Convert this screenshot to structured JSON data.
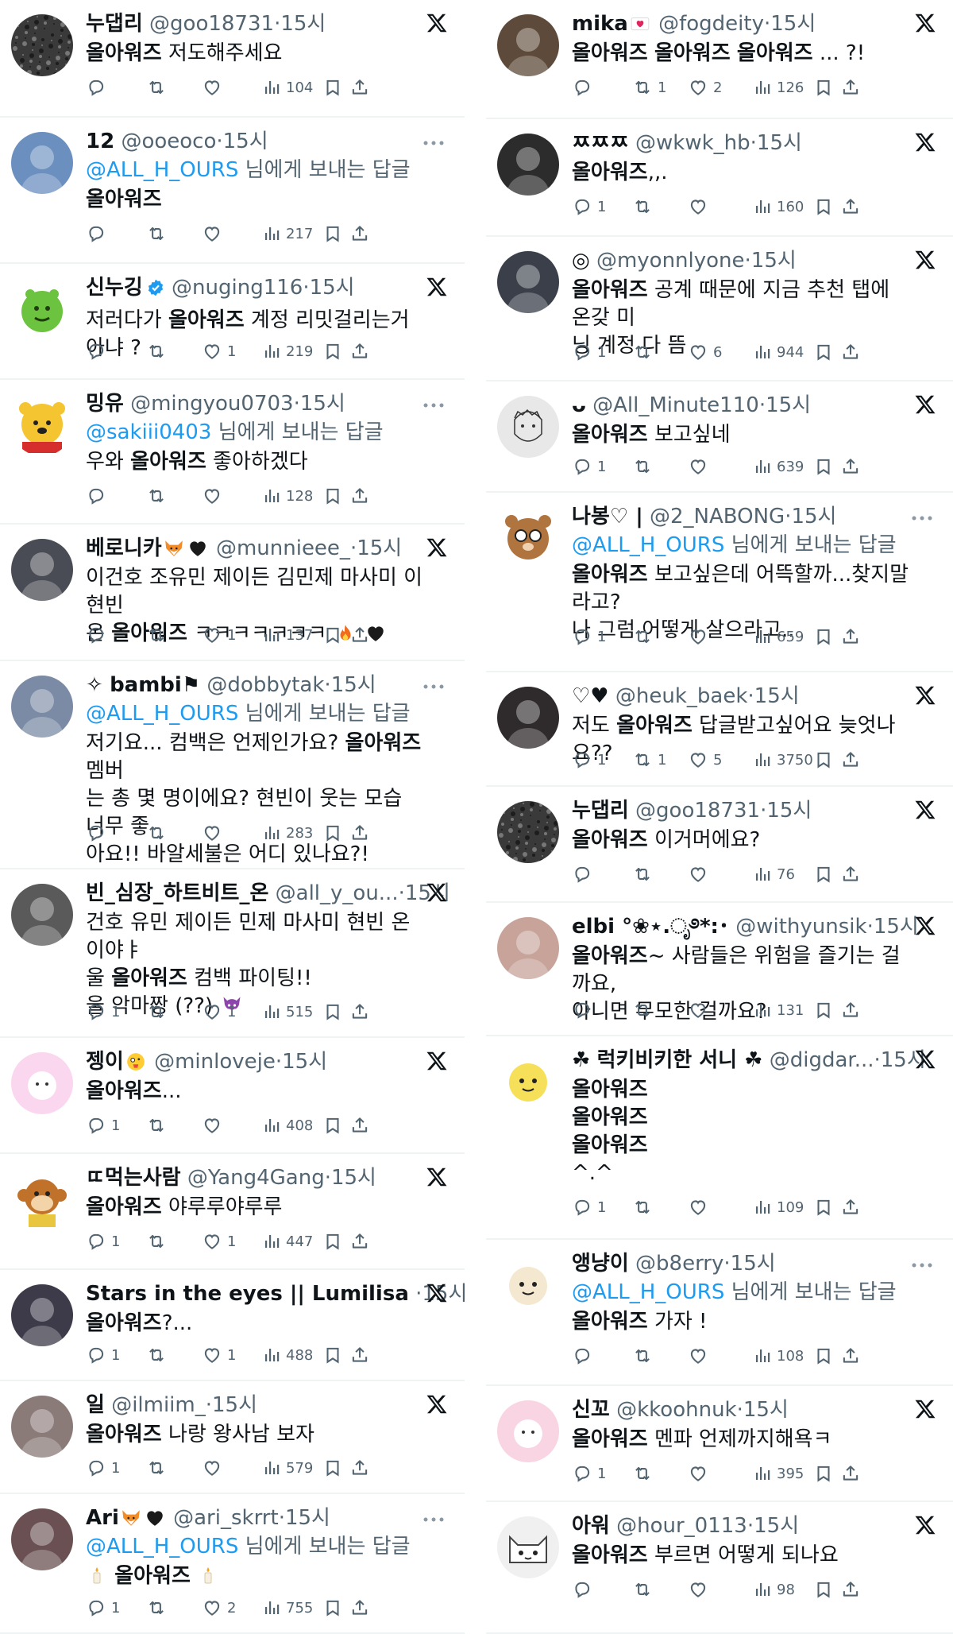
{
  "left": [
    {
      "name": "누댑리",
      "handle": "@goo18731",
      "time": "15시",
      "reply_to": null,
      "lines": [
        "{{올아워즈}} 저도해주세요"
      ],
      "counts": {
        "reply": "",
        "repost": "",
        "like": "",
        "views": "104"
      },
      "corner": "x",
      "avatar": {
        "type": "texture",
        "color": "#3a3a3a"
      }
    },
    {
      "name": "12",
      "handle": "@ooeoco",
      "time": "15시",
      "reply_to": "@ALL_H_OURS",
      "lines": [
        "{{올아워즈}}"
      ],
      "counts": {
        "reply": "",
        "repost": "",
        "like": "",
        "views": "217"
      },
      "corner": "more",
      "avatar": {
        "type": "photo",
        "color": "#6b8fbf"
      }
    },
    {
      "name": "신누깅",
      "handle": "@nuging116",
      "time": "15시",
      "reply_to": null,
      "verified": true,
      "lines": [
        "저러다가 {{올아워즈}} 계정 리밋걸리는거아냐 ?"
      ],
      "counts": {
        "reply": "",
        "repost": "",
        "like": "1",
        "views": "219"
      },
      "corner": "x",
      "avatar": {
        "type": "green",
        "color": "#6cc33f"
      }
    },
    {
      "name": "밍유",
      "handle": "@mingyou0703",
      "time": "15시",
      "reply_to": "@sakiii0403",
      "lines": [
        "우와 {{올아워즈}} 좋아하겠다"
      ],
      "counts": {
        "reply": "",
        "repost": "",
        "like": "",
        "views": "128"
      },
      "corner": "more",
      "avatar": {
        "type": "pooh",
        "color": "#f4c531"
      }
    },
    {
      "name": "베로니카",
      "name_emoji": [
        "fox",
        "heart"
      ],
      "handle": "@munnieee_",
      "time": "15시",
      "reply_to": null,
      "lines": [
        "이건호 조유민 제이든 김민제 마사미 이현빈",
        "온 {{올아워즈}} ㅋㅋㅋㅋㅋㅋㅋ [fire] [heart]"
      ],
      "counts": {
        "reply": "",
        "repost": "",
        "like": "1",
        "views": "137"
      },
      "corner": "x",
      "avatar": {
        "type": "photo",
        "color": "#4a4c55"
      }
    },
    {
      "name": "bambi",
      "name_prefix": "✧",
      "name_suffix": "⚑",
      "handle": "@dobbytak",
      "time": "15시",
      "reply_to": "@ALL_H_OURS",
      "lines": [
        "저기요... 컴백은 언제인가요? {{올아워즈}} 멤버",
        "는 총 몇 명이에요? 현빈이 웃는 모습 너무 좋",
        "아요!! 바알세불은 어디 있나요?!"
      ],
      "counts": {
        "reply": "",
        "repost": "",
        "like": "",
        "views": "283"
      },
      "corner": "more",
      "avatar": {
        "type": "photo",
        "color": "#7b8ba5"
      }
    },
    {
      "name": "빈_심장_하트비트_온",
      "handle": "@all_y_ou...",
      "time": "15시",
      "reply_to": null,
      "lines": [
        "건호 유민 제이든 민제 마사미 현빈 온이야ㅑ",
        "울 {{올아워즈}} 컴백 파이팅!!",
        "울 악마짱 (??) [devil]"
      ],
      "counts": {
        "reply": "1",
        "repost": "",
        "like": "1",
        "views": "515"
      },
      "corner": "x",
      "avatar": {
        "type": "photo",
        "color": "#5a5a5a"
      }
    },
    {
      "name": "젱이",
      "name_emoji": [
        "zany"
      ],
      "handle": "@minloveje",
      "time": "15시",
      "reply_to": null,
      "lines": [
        "{{올아워즈}}..."
      ],
      "counts": {
        "reply": "1",
        "repost": "",
        "like": "",
        "views": "408"
      },
      "corner": "x",
      "avatar": {
        "type": "pink",
        "color": "#fbd7ef"
      }
    },
    {
      "name": "ㄸ먹는사람",
      "handle": "@Yang4Gang",
      "time": "15시",
      "reply_to": null,
      "lines": [
        "{{올아워즈}} 야루루야루루"
      ],
      "counts": {
        "reply": "1",
        "repost": "",
        "like": "1",
        "views": "447"
      },
      "corner": "x",
      "avatar": {
        "type": "monkey",
        "color": "#c0712a"
      }
    },
    {
      "name": "Stars in the eyes || Lumilisa",
      "handle": "",
      "time": "15시",
      "reply_to": null,
      "lines": [
        "{{올아워즈}}?..."
      ],
      "counts": {
        "reply": "1",
        "repost": "",
        "like": "1",
        "views": "488"
      },
      "corner": "x",
      "avatar": {
        "type": "photo",
        "color": "#3d3a49"
      }
    },
    {
      "name": "일",
      "handle": "@ilmiim_",
      "time": "15시",
      "reply_to": null,
      "lines": [
        "{{올아워즈}} 나랑 왕사남 보자"
      ],
      "counts": {
        "reply": "1",
        "repost": "",
        "like": "",
        "views": "579"
      },
      "corner": "x",
      "avatar": {
        "type": "photo",
        "color": "#8a7a78"
      }
    },
    {
      "name": "Ari",
      "name_emoji": [
        "fox",
        "heart"
      ],
      "handle": "@ari_skrrt",
      "time": "15시",
      "reply_to": "@ALL_H_OURS",
      "lines": [
        "[candle] {{올아워즈}} [candle]"
      ],
      "counts": {
        "reply": "1",
        "repost": "",
        "like": "2",
        "views": "755"
      },
      "corner": "more",
      "avatar": {
        "type": "photo",
        "color": "#6a5052"
      }
    }
  ],
  "right": [
    {
      "name": "mika",
      "name_emoji": [
        "heartmail"
      ],
      "handle": "@fogdeity",
      "time": "15시",
      "reply_to": null,
      "lines": [
        "{{올아워즈}} {{올아워즈}} {{올아워즈}} ... ?!"
      ],
      "counts": {
        "reply": "",
        "repost": "1",
        "like": "2",
        "views": "126"
      },
      "corner": "x",
      "avatar": {
        "type": "photo",
        "color": "#5e4a3a"
      }
    },
    {
      "name": "ㅉㅉㅉ",
      "handle": "@wkwk_hb",
      "time": "15시",
      "reply_to": null,
      "lines": [
        "{{올아워즈}},,."
      ],
      "counts": {
        "reply": "1",
        "repost": "",
        "like": "",
        "views": "160"
      },
      "corner": "x",
      "avatar": {
        "type": "photo",
        "color": "#2c2c2c"
      }
    },
    {
      "name": "",
      "name_prefix": "◎",
      "handle": "@myonnlyone",
      "time": "15시",
      "reply_to": null,
      "lines": [
        "{{올아워즈}} 공계 때문에 지금 추천 탭에 온갖 미",
        "닝 계정 다 뜸"
      ],
      "counts": {
        "reply": "1",
        "repost": "",
        "like": "6",
        "views": "944"
      },
      "corner": "x",
      "avatar": {
        "type": "photo",
        "color": "#3a3f4a"
      }
    },
    {
      "name": "",
      "name_prefix": "ᴗ",
      "handle": "@All_Minute110",
      "time": "15시",
      "reply_to": null,
      "lines": [
        "{{올아워즈}} 보고싶네"
      ],
      "counts": {
        "reply": "1",
        "repost": "",
        "like": "",
        "views": "639"
      },
      "corner": "x",
      "avatar": {
        "type": "sketch",
        "color": "#e8e8e8"
      }
    },
    {
      "name": "나봉♡ |",
      "handle": "@2_NABONG",
      "time": "15시",
      "reply_to": "@ALL_H_OURS",
      "lines": [
        "{{올아워즈}} 보고싶은데 어뜩할까...찾지말라고?",
        "나 그럼 어떻게 살으라고.."
      ],
      "counts": {
        "reply": "1",
        "repost": "",
        "like": "",
        "views": "659"
      },
      "corner": "more",
      "avatar": {
        "type": "bear",
        "color": "#b0743f"
      }
    },
    {
      "name": "♡♥",
      "handle": "@heuk_baek",
      "time": "15시",
      "reply_to": null,
      "lines": [
        "저도 {{올아워즈}} 답글받고싶어요 늦엇나요??"
      ],
      "counts": {
        "reply": "1",
        "repost": "1",
        "like": "5",
        "views": "3750"
      },
      "corner": "x",
      "avatar": {
        "type": "photo",
        "color": "#2f2a2b"
      }
    },
    {
      "name": "누댑리",
      "handle": "@goo18731",
      "time": "15시",
      "reply_to": null,
      "lines": [
        "{{올아워즈}} 이거머에요?"
      ],
      "counts": {
        "reply": "",
        "repost": "",
        "like": "",
        "views": "76"
      },
      "corner": "x",
      "avatar": {
        "type": "texture",
        "color": "#3a3a3a"
      }
    },
    {
      "name": "elbi",
      "name_suffix": " °❀⋆.ೃ࿔*:･",
      "handle": "@withyunsik",
      "time": "15시",
      "reply_to": null,
      "lines": [
        "{{올아워즈}}~ 사람들은 위험을 즐기는 걸까요,",
        "아니면 무모한 걸까요?"
      ],
      "counts": {
        "reply": "",
        "repost": "",
        "like": "",
        "views": "131"
      },
      "corner": "x",
      "avatar": {
        "type": "photo",
        "color": "#c7a39a"
      }
    },
    {
      "name": "럭키비키한 서니",
      "name_prefix": "☘",
      "name_suffix": " ☘",
      "handle": "@digdar...",
      "time": "15시",
      "reply_to": null,
      "lines": [
        "{{올아워즈}}",
        "{{올아워즈}}",
        "{{올아워즈}}",
        "^.^"
      ],
      "counts": {
        "reply": "1",
        "repost": "",
        "like": "",
        "views": "109"
      },
      "corner": "x",
      "avatar": {
        "type": "cartoon",
        "color": "#f6e05a"
      }
    },
    {
      "name": "앵냥이",
      "handle": "@b8erry",
      "time": "15시",
      "reply_to": "@ALL_H_OURS",
      "lines": [
        "{{올아워즈}} 가자 !"
      ],
      "counts": {
        "reply": "",
        "repost": "",
        "like": "",
        "views": "108"
      },
      "corner": "more",
      "avatar": {
        "type": "cartoon",
        "color": "#f4e8d0"
      }
    },
    {
      "name": "신꼬",
      "handle": "@kkoohnuk",
      "time": "15시",
      "reply_to": null,
      "lines": [
        "{{올아워즈}} 멘파 언제까지해욕ㅋ"
      ],
      "counts": {
        "reply": "1",
        "repost": "",
        "like": "",
        "views": "395"
      },
      "corner": "x",
      "avatar": {
        "type": "pink",
        "color": "#f9d4e3"
      }
    },
    {
      "name": "아워",
      "handle": "@hour_0113",
      "time": "15시",
      "reply_to": null,
      "lines": [
        "{{올아워즈}} 부르면 어떻게 되나요"
      ],
      "counts": {
        "reply": "",
        "repost": "",
        "like": "",
        "views": "98"
      },
      "corner": "x",
      "avatar": {
        "type": "cat",
        "color": "#f0f0f0"
      }
    }
  ],
  "strings": {
    "reply_suffix": " 님에게 보내는 답글",
    "dot": "·"
  },
  "colors": {
    "text": "#0f1419",
    "muted": "#536471",
    "link": "#1d9bf0",
    "divider": "#eff3f4"
  }
}
